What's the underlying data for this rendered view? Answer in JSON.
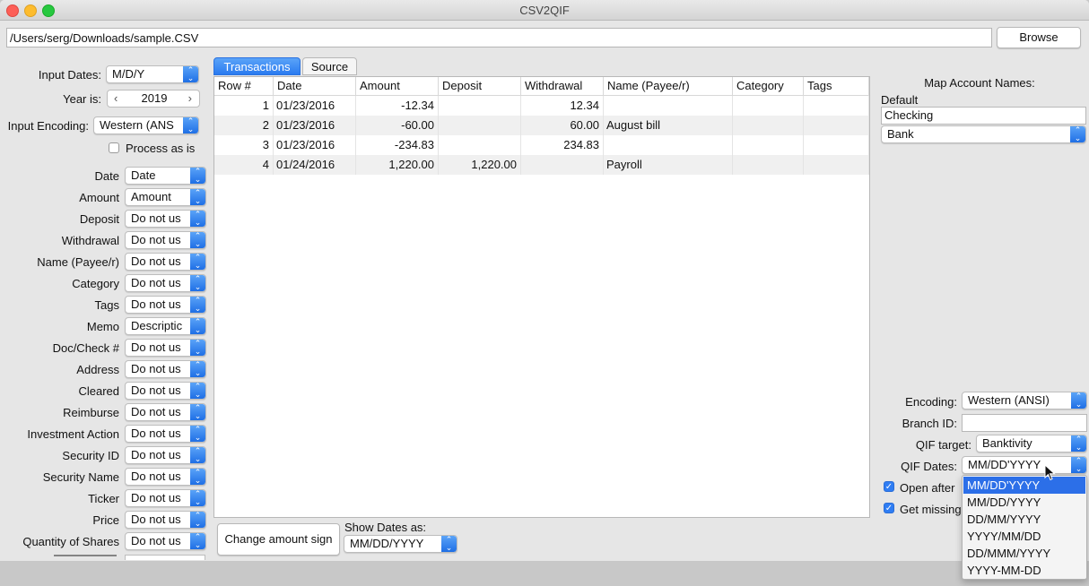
{
  "window": {
    "title": "CSV2QIF"
  },
  "file": {
    "path": "/Users/serg/Downloads/sample.CSV",
    "browse_label": "Browse"
  },
  "left": {
    "input_dates_label": "Input Dates:",
    "input_dates_value": "M/D/Y",
    "year_label": "Year is:",
    "year_value": "2019",
    "encoding_label": "Input Encoding:",
    "encoding_value": "Western (ANS",
    "process_as_is": "Process as is",
    "mappings": [
      {
        "label": "Date",
        "value": "Date"
      },
      {
        "label": "Amount",
        "value": "Amount"
      },
      {
        "label": "Deposit",
        "value": "Do not us"
      },
      {
        "label": "Withdrawal",
        "value": "Do not us"
      },
      {
        "label": "Name (Payee/r)",
        "value": "Do not us"
      },
      {
        "label": "Category",
        "value": "Do not us"
      },
      {
        "label": "Tags",
        "value": "Do not us"
      },
      {
        "label": "Memo",
        "value": "Descriptic"
      },
      {
        "label": "Doc/Check #",
        "value": "Do not us"
      },
      {
        "label": "Address",
        "value": "Do not us"
      },
      {
        "label": "Cleared",
        "value": "Do not us"
      },
      {
        "label": "Reimburse",
        "value": "Do not us"
      },
      {
        "label": "Investment Action",
        "value": "Do not us"
      },
      {
        "label": "Security ID",
        "value": "Do not us"
      },
      {
        "label": "Security Name",
        "value": "Do not us"
      },
      {
        "label": "Ticker",
        "value": "Do not us"
      },
      {
        "label": "Price",
        "value": "Do not us"
      },
      {
        "label": "Quantity of Shares",
        "value": "Do not us"
      }
    ]
  },
  "tabs": [
    {
      "label": "Transactions"
    },
    {
      "label": "Source"
    }
  ],
  "table": {
    "columns": [
      "Row #",
      "Date",
      "Amount",
      "Deposit",
      "Withdrawal",
      "Name (Payee/r)",
      "Category",
      "Tags"
    ],
    "rows": [
      [
        "1",
        "01/23/2016",
        "-12.34",
        "",
        "12.34",
        "",
        "",
        ""
      ],
      [
        "2",
        "01/23/2016",
        "-60.00",
        "",
        "60.00",
        "August bill",
        "",
        ""
      ],
      [
        "3",
        "01/23/2016",
        "-234.83",
        "",
        "234.83",
        "",
        "",
        ""
      ],
      [
        "4",
        "01/24/2016",
        "1,220.00",
        "1,220.00",
        "",
        "Payroll",
        "",
        ""
      ]
    ]
  },
  "bottom": {
    "change_sign_label": "Change amount sign",
    "show_dates_label": "Show Dates as:",
    "show_dates_value": "MM/DD/YYYY"
  },
  "right": {
    "map_accounts_label": "Map Account Names:",
    "default_label": "Default",
    "account_name": "Checking",
    "account_type": "Bank",
    "encoding_label": "Encoding:",
    "encoding_value": "Western (ANSI)",
    "branch_label": "Branch ID:",
    "branch_value": "",
    "qif_target_label": "QIF target:",
    "qif_target_value": "Banktivity",
    "qif_dates_label": "QIF Dates:",
    "qif_dates_value": "MM/DD'YYYY",
    "open_after_label": "Open after",
    "get_missing_label": "Get missing"
  },
  "qif_dates_options": [
    "MM/DD'YYYY",
    "MM/DD/YYYY",
    "DD/MM/YYYY",
    "YYYY/MM/DD",
    "DD/MMM/YYYY",
    "YYYY-MM-DD"
  ],
  "colors": {
    "accent": "#2c6fe8",
    "window_bg": "#e6e6e6"
  }
}
